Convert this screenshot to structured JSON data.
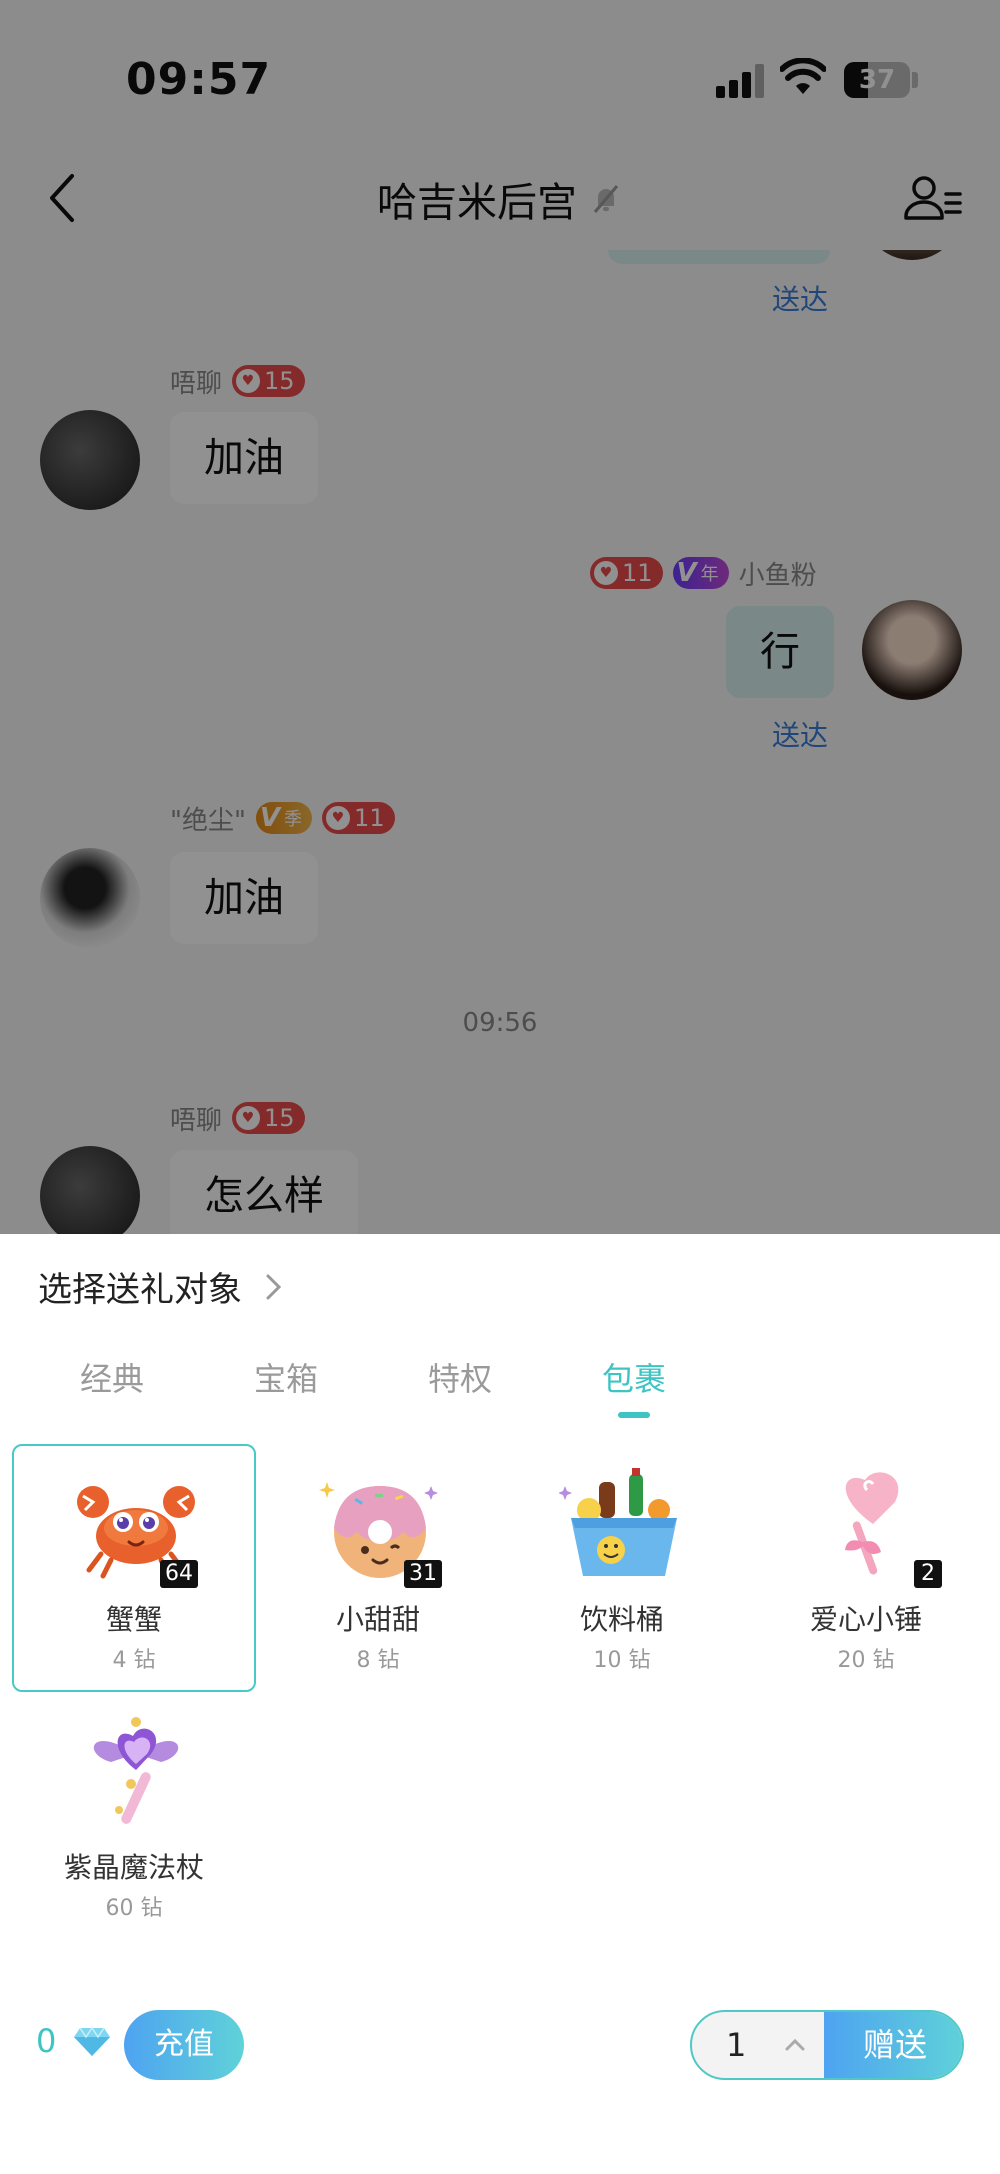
{
  "status_bar": {
    "time": "09:57",
    "battery": "37",
    "battery_level": 0.37
  },
  "nav": {
    "title": "哈吉米后宫"
  },
  "chat": {
    "messages": [
      {
        "sender": "唔聊",
        "badge": "15",
        "text": "加油"
      },
      {
        "sender": "小鱼粉",
        "badge": "11",
        "vip_label": "年",
        "text": "行",
        "status": "送达"
      },
      {
        "sender": "\"绝尘\"",
        "vip_label": "季",
        "badge": "11",
        "text": "加油"
      },
      {
        "sender": "唔聊",
        "badge": "15",
        "text": "怎么样"
      }
    ],
    "top_status": "送达",
    "timestamp": "09:56"
  },
  "gift_panel": {
    "target_label": "选择送礼对象",
    "tabs": [
      {
        "label": "经典"
      },
      {
        "label": "宝箱"
      },
      {
        "label": "特权"
      },
      {
        "label": "包裹",
        "active": true
      }
    ],
    "gifts": [
      {
        "name": "蟹蟹",
        "price": "4 钻",
        "count": "64",
        "selected": true,
        "icon": "crab-icon"
      },
      {
        "name": "小甜甜",
        "price": "8 钻",
        "count": "31",
        "icon": "donut-icon"
      },
      {
        "name": "饮料桶",
        "price": "10 钻",
        "count": "",
        "icon": "drink-bucket-icon"
      },
      {
        "name": "爱心小锤",
        "price": "20 钻",
        "count": "2",
        "icon": "heart-hammer-icon"
      },
      {
        "name": "紫晶魔法杖",
        "price": "60 钻",
        "count": "",
        "icon": "magic-wand-icon"
      }
    ],
    "balance": "0",
    "recharge_label": "充值",
    "quantity": "1",
    "send_label": "赠送",
    "accent_color": "#3fc4c4"
  }
}
